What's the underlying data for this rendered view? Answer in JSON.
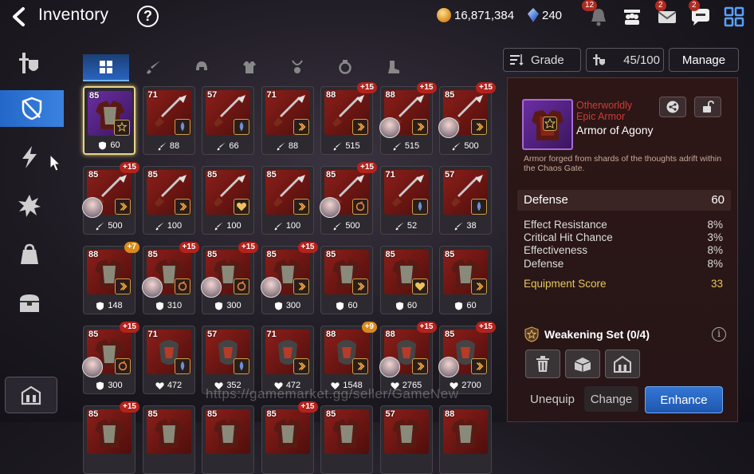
{
  "header": {
    "title": "Inventory",
    "gold": "16,871,384",
    "gems": "240",
    "notifications": [
      {
        "name": "bell-icon",
        "badge": "12"
      },
      {
        "name": "party-icon",
        "badge": ""
      },
      {
        "name": "mail-icon",
        "badge": "2"
      },
      {
        "name": "chat-icon",
        "badge": "2"
      },
      {
        "name": "grid-menu-icon",
        "badge": ""
      }
    ]
  },
  "sidebar": {
    "items": [
      {
        "icon": "weapon-armor-icon",
        "active": false
      },
      {
        "icon": "shield-slash-icon",
        "active": true
      },
      {
        "icon": "lightning-icon",
        "active": false
      },
      {
        "icon": "splash-icon",
        "active": false
      },
      {
        "icon": "bag-icon",
        "active": false
      },
      {
        "icon": "chest-icon",
        "active": false
      }
    ],
    "bottom_icon": "storage-icon"
  },
  "tabs": [
    {
      "icon": "all-grid-icon",
      "active": true
    },
    {
      "icon": "weapon-icon",
      "active": false
    },
    {
      "icon": "helmet-icon",
      "active": false
    },
    {
      "icon": "armor-icon",
      "active": false
    },
    {
      "icon": "necklace-icon",
      "active": false
    },
    {
      "icon": "ring-icon",
      "active": false
    },
    {
      "icon": "boots-icon",
      "active": false
    }
  ],
  "filters": {
    "grade_label": "Grade",
    "capacity": "45/100",
    "manage_label": "Manage"
  },
  "items": [
    [
      {
        "level": "85",
        "plus": "",
        "stat": "60",
        "stat_type": "defense",
        "rarity": "epic",
        "set": "weakening",
        "portrait": false,
        "selected": true
      },
      {
        "level": "71",
        "plus": "",
        "stat": "88",
        "stat_type": "attack",
        "rarity": "epic",
        "set": "critical",
        "portrait": false
      },
      {
        "level": "57",
        "plus": "",
        "stat": "66",
        "stat_type": "attack",
        "rarity": "epic",
        "set": "critical",
        "portrait": false
      },
      {
        "level": "71",
        "plus": "",
        "stat": "88",
        "stat_type": "attack",
        "rarity": "epic",
        "set": "speed",
        "portrait": false
      },
      {
        "level": "88",
        "plus": "+15",
        "stat": "515",
        "stat_type": "attack",
        "rarity": "epic",
        "set": "speed",
        "portrait": false
      },
      {
        "level": "88",
        "plus": "+15",
        "stat": "515",
        "stat_type": "attack",
        "rarity": "epic",
        "set": "speed",
        "portrait": true
      },
      {
        "level": "85",
        "plus": "+15",
        "stat": "500",
        "stat_type": "attack",
        "rarity": "epic",
        "set": "speed",
        "portrait": true
      }
    ],
    [
      {
        "level": "85",
        "plus": "+15",
        "stat": "500",
        "stat_type": "attack",
        "rarity": "epic",
        "set": "speed",
        "portrait": true
      },
      {
        "level": "85",
        "plus": "",
        "stat": "100",
        "stat_type": "attack",
        "rarity": "epic",
        "set": "speed",
        "portrait": false
      },
      {
        "level": "85",
        "plus": "",
        "stat": "100",
        "stat_type": "attack",
        "rarity": "epic",
        "set": "health",
        "portrait": false
      },
      {
        "level": "85",
        "plus": "",
        "stat": "100",
        "stat_type": "attack",
        "rarity": "epic",
        "set": "speed",
        "portrait": false
      },
      {
        "level": "85",
        "plus": "+15",
        "stat": "500",
        "stat_type": "attack",
        "rarity": "epic",
        "set": "counter",
        "portrait": true
      },
      {
        "level": "71",
        "plus": "",
        "stat": "52",
        "stat_type": "attack",
        "rarity": "epic",
        "set": "critical",
        "portrait": false
      },
      {
        "level": "57",
        "plus": "",
        "stat": "38",
        "stat_type": "attack",
        "rarity": "epic",
        "set": "critical",
        "portrait": false
      }
    ],
    [
      {
        "level": "88",
        "plus": "+7",
        "stat": "148",
        "stat_type": "defense",
        "rarity": "epic",
        "set": "speed",
        "portrait": false
      },
      {
        "level": "85",
        "plus": "+15",
        "stat": "310",
        "stat_type": "defense",
        "rarity": "epic",
        "set": "counter",
        "portrait": true
      },
      {
        "level": "85",
        "plus": "+15",
        "stat": "300",
        "stat_type": "defense",
        "rarity": "epic",
        "set": "counter",
        "portrait": true
      },
      {
        "level": "85",
        "plus": "+15",
        "stat": "300",
        "stat_type": "defense",
        "rarity": "epic",
        "set": "speed",
        "portrait": true
      },
      {
        "level": "85",
        "plus": "",
        "stat": "60",
        "stat_type": "defense",
        "rarity": "epic",
        "set": "speed",
        "portrait": false
      },
      {
        "level": "85",
        "plus": "",
        "stat": "60",
        "stat_type": "defense",
        "rarity": "epic",
        "set": "health",
        "portrait": false
      },
      {
        "level": "85",
        "plus": "",
        "stat": "60",
        "stat_type": "defense",
        "rarity": "epic",
        "set": "speed",
        "portrait": false
      }
    ],
    [
      {
        "level": "85",
        "plus": "+15",
        "stat": "300",
        "stat_type": "defense",
        "rarity": "epic",
        "set": "counter",
        "portrait": true
      },
      {
        "level": "71",
        "plus": "",
        "stat": "472",
        "stat_type": "health",
        "rarity": "epic",
        "set": "critical",
        "portrait": false
      },
      {
        "level": "57",
        "plus": "",
        "stat": "352",
        "stat_type": "health",
        "rarity": "epic",
        "set": "critical",
        "portrait": false
      },
      {
        "level": "71",
        "plus": "",
        "stat": "472",
        "stat_type": "health",
        "rarity": "epic",
        "set": "speed",
        "portrait": false
      },
      {
        "level": "88",
        "plus": "+9",
        "stat": "1548",
        "stat_type": "health",
        "rarity": "epic",
        "set": "speed",
        "portrait": false
      },
      {
        "level": "88",
        "plus": "+15",
        "stat": "2765",
        "stat_type": "health",
        "rarity": "epic",
        "set": "speed",
        "portrait": true
      },
      {
        "level": "85",
        "plus": "+15",
        "stat": "2700",
        "stat_type": "health",
        "rarity": "epic",
        "set": "speed",
        "portrait": true
      }
    ],
    [
      {
        "level": "85",
        "plus": "+15",
        "stat": "",
        "stat_type": "",
        "rarity": "epic",
        "set": "",
        "portrait": false
      },
      {
        "level": "85",
        "plus": "",
        "stat": "",
        "stat_type": "",
        "rarity": "epic",
        "set": "",
        "portrait": false
      },
      {
        "level": "85",
        "plus": "",
        "stat": "",
        "stat_type": "",
        "rarity": "epic",
        "set": "",
        "portrait": false
      },
      {
        "level": "85",
        "plus": "+15",
        "stat": "",
        "stat_type": "",
        "rarity": "epic",
        "set": "",
        "portrait": false
      },
      {
        "level": "85",
        "plus": "",
        "stat": "",
        "stat_type": "",
        "rarity": "epic",
        "set": "",
        "portrait": false
      },
      {
        "level": "57",
        "plus": "",
        "stat": "",
        "stat_type": "",
        "rarity": "epic",
        "set": "",
        "portrait": false
      },
      {
        "level": "88",
        "plus": "",
        "stat": "",
        "stat_type": "",
        "rarity": "epic",
        "set": "",
        "portrait": false
      }
    ]
  ],
  "detail": {
    "line1": "Otherworldly",
    "line2": "Epic Armor",
    "name": "Armor of Agony",
    "description": "Armor forged from shards of the thoughts adrift within the Chaos Gate.",
    "main_stat": {
      "label": "Defense",
      "value": "60"
    },
    "substats": [
      {
        "label": "Effect Resistance",
        "value": "8%"
      },
      {
        "label": "Critical Hit Chance",
        "value": "3%"
      },
      {
        "label": "Effectiveness",
        "value": "8%"
      },
      {
        "label": "Defense",
        "value": "8%"
      }
    ],
    "score": {
      "label": "Equipment Score",
      "value": "33"
    },
    "set": "Weakening Set (0/4)",
    "buttons": {
      "unequip": "Unequip",
      "change": "Change",
      "enhance": "Enhance"
    }
  },
  "watermark": "https://gamemarket.gg/seller/GameNew",
  "colors": {
    "accent_blue": "#2a64c0",
    "epic_red": "#d03b33",
    "score_gold": "#e8c85a",
    "selected_border": "#e8d48a"
  }
}
